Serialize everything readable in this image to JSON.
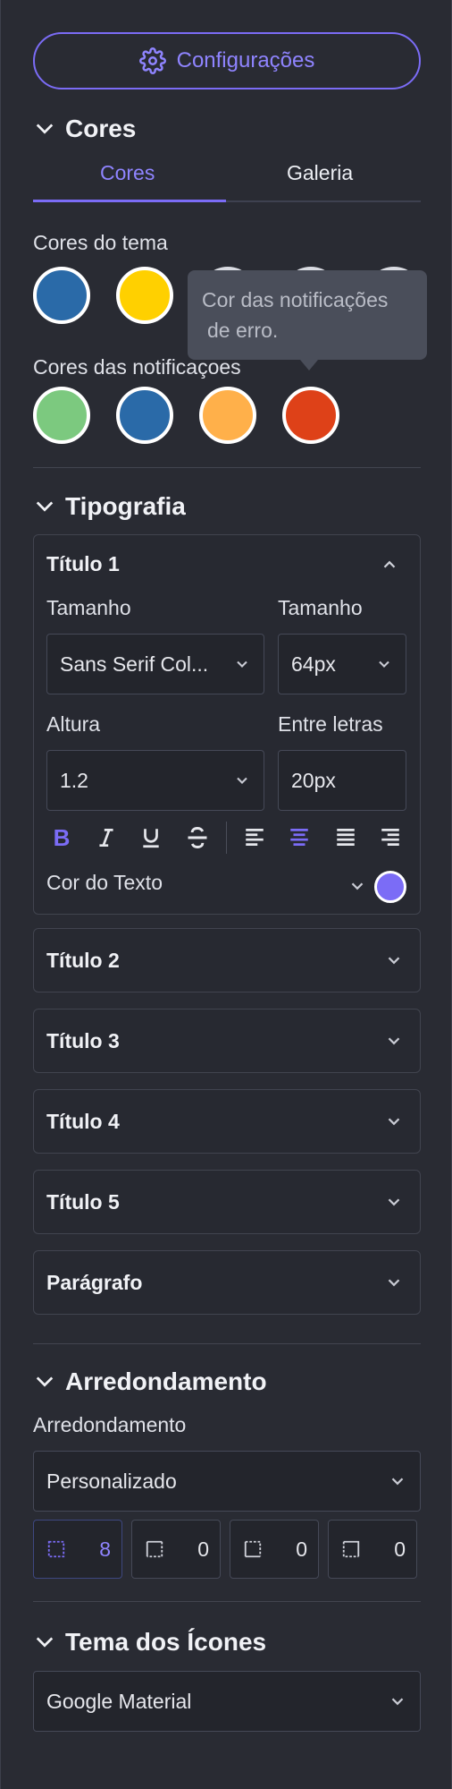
{
  "header": {
    "config_button": "Configurações",
    "icon": "gear-icon"
  },
  "colors_section": {
    "title": "Cores",
    "tabs": [
      {
        "label": "Cores",
        "active": true
      },
      {
        "label": "Galeria",
        "active": false
      }
    ],
    "theme_label": "Cores do tema",
    "theme_colors": [
      "#2a6aa8",
      "#ffd000"
    ],
    "notif_label": "Cores das notificaçoes",
    "notif_colors": [
      "#7cc97f",
      "#2a6aa8",
      "#ffb04a",
      "#de4118"
    ],
    "tooltip_line1": "Cor das notificações",
    "tooltip_line2": "de erro."
  },
  "typography": {
    "title": "Tipografia",
    "expanded_item": {
      "title": "Título 1",
      "size_label": "Tamanho",
      "font_value": "Sans Serif Col...",
      "size_label2": "Tamanho",
      "size_value": "64px",
      "height_label": "Altura",
      "height_value": "1.2",
      "spacing_label": "Entre letras",
      "spacing_value": "20px",
      "text_color_label": "Cor do Texto",
      "text_color": "#7b6cf6",
      "format_icons": [
        "bold-icon",
        "italic-icon",
        "underline-icon",
        "strikethrough-icon",
        "align-left-icon",
        "align-center-icon",
        "align-justify-icon",
        "align-right-icon"
      ],
      "active_format": [
        "bold-icon",
        "align-center-icon"
      ]
    },
    "items": [
      "Título 2",
      "Título 3",
      "Título 4",
      "Título 5",
      "Parágrafo"
    ]
  },
  "rounding": {
    "title": "Arredondamento",
    "label": "Arredondamento",
    "select_value": "Personalizado",
    "corners": [
      {
        "icon": "corner-all-icon",
        "value": "8",
        "active": true
      },
      {
        "icon": "corner-top-left-icon",
        "value": "0",
        "active": false
      },
      {
        "icon": "corner-bottom-left-icon",
        "value": "0",
        "active": false
      },
      {
        "icon": "corner-top-right-icon",
        "value": "0",
        "active": false
      }
    ]
  },
  "icons_theme": {
    "title": "Tema dos Ícones",
    "select_value": "Google Material"
  },
  "accent": "#7b6cf6"
}
